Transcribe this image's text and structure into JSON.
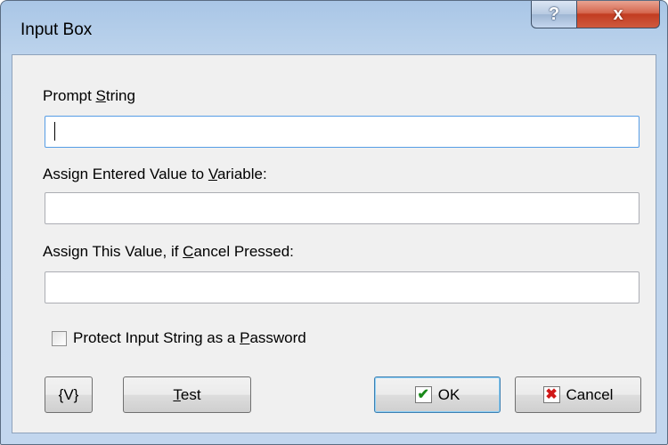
{
  "window": {
    "title": "Input Box",
    "help_glyph": "?",
    "close_glyph": "x"
  },
  "prompt": {
    "label_pre": "Prompt ",
    "label_key": "S",
    "label_post": "tring",
    "value": ""
  },
  "assign_var": {
    "label_pre": "Assign Entered Value to ",
    "label_key": "V",
    "label_post": "ariable:",
    "value": ""
  },
  "cancel_value": {
    "label_pre": "Assign This Value, if ",
    "label_key": "C",
    "label_post": "ancel Pressed:",
    "value": ""
  },
  "password": {
    "label_pre": "Protect Input String as a ",
    "label_key": "P",
    "label_post": "assword",
    "checked": false
  },
  "buttons": {
    "variable_label": "{V}",
    "test_key": "T",
    "test_post": "est",
    "ok_label": "OK",
    "ok_icon": "check-icon",
    "ok_glyph": "✔",
    "cancel_label": "Cancel",
    "cancel_icon": "x-icon",
    "cancel_glyph": "✖"
  }
}
